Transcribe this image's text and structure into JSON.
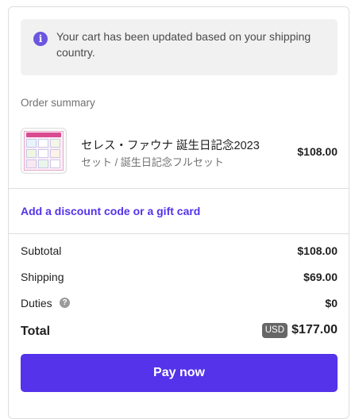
{
  "notice": {
    "icon": "info-icon",
    "text": "Your cart has been updated based on your shipping country."
  },
  "order_summary": {
    "label": "Order summary",
    "item": {
      "name": "セレス・ファウナ 誕生日記念2023",
      "variant": "セット / 誕生日記念フルセット",
      "price": "$108.00",
      "thumbnail": "product-thumbnail"
    }
  },
  "discount": {
    "link_label": "Add a discount code or a gift card"
  },
  "costs": {
    "subtotal_label": "Subtotal",
    "subtotal_value": "$108.00",
    "shipping_label": "Shipping",
    "shipping_value": "$69.00",
    "duties_label": "Duties",
    "duties_value": "$0",
    "duties_help_icon": "question-circle-icon"
  },
  "total": {
    "label": "Total",
    "currency": "USD",
    "value": "$177.00"
  },
  "actions": {
    "pay_label": "Pay now"
  },
  "colors": {
    "accent": "#5433eb",
    "info_icon": "#6b56e0",
    "notice_bg": "#f1f1f1",
    "badge_bg": "#666666"
  }
}
